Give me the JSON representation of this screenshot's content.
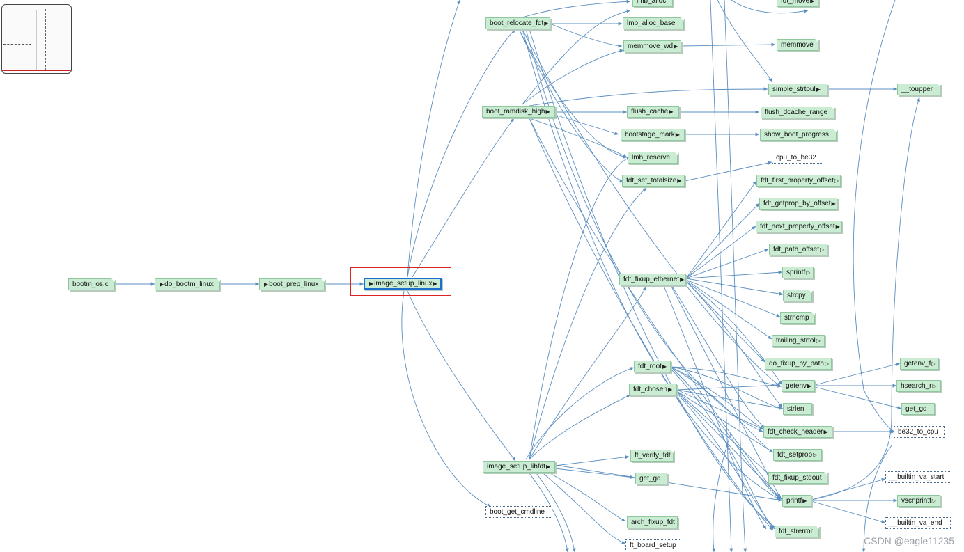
{
  "nodes": {
    "bootm_os_c": "bootm_os.c",
    "do_bootm_linux": "do_bootm_linux",
    "boot_prep_linux": "boot_prep_linux",
    "image_setup_linux": "image_setup_linux",
    "boot_relocate_fdt": "boot_relocate_fdt",
    "boot_ramdisk_high": "boot_ramdisk_high",
    "image_setup_libfdt": "image_setup_libfdt",
    "boot_get_cmdline": "boot_get_cmdline",
    "lmb_alloc": "lmb_alloc",
    "lmb_alloc_base": "lmb_alloc_base",
    "memmove_wd": "memmove_wd",
    "flush_cache": "flush_cache",
    "bootstage_mark": "bootstage_mark",
    "lmb_reserve": "lmb_reserve",
    "fdt_set_totalsize": "fdt_set_totalsize",
    "fdt_fixup_ethernet": "fdt_fixup_ethernet",
    "fdt_root": "fdt_root",
    "fdt_chosen": "fdt_chosen",
    "ft_verify_fdt": "ft_verify_fdt",
    "get_gd": "get_gd",
    "arch_fixup_fdt": "arch_fixup_fdt",
    "ft_board_setup": "ft_board_setup",
    "fdt_move": "fdt_move",
    "memmove": "memmove",
    "simple_strtoul": "simple_strtoul",
    "flush_dcache_range": "flush_dcache_range",
    "show_boot_progress": "show_boot_progress",
    "cpu_to_be32": "cpu_to_be32",
    "fdt_first_property_offset": "fdt_first_property_offset",
    "fdt_getprop_by_offset": "fdt_getprop_by_offset",
    "fdt_next_property_offset": "fdt_next_property_offset",
    "fdt_path_offset": "fdt_path_offset",
    "sprintf": "sprintf",
    "strcpy": "strcpy",
    "strncmp": "strncmp",
    "trailing_strtol": "trailing_strtol",
    "do_fixup_by_path": "do_fixup_by_path",
    "getenv": "getenv",
    "strlen": "strlen",
    "fdt_check_header": "fdt_check_header",
    "fdt_setprop": "fdt_setprop",
    "fdt_fixup_stdout": "fdt_fixup_stdout",
    "printf": "printf",
    "fdt_strerror": "fdt_strerror",
    "toupper": "__toupper",
    "getenv_f": "getenv_f",
    "hsearch_r": "hsearch_r",
    "get_gd_2": "get_gd",
    "be32_to_cpu": "be32_to_cpu",
    "builtin_va_start": "__builtin_va_start",
    "vscnprintf": "vscnprintf",
    "builtin_va_end": "__builtin_va_end"
  },
  "watermark": "CSDN @eagle11235",
  "colors": {
    "node_fill": "#c9ecd2",
    "node_border": "#8fc79f",
    "edge": "#5b8fc0",
    "selected_border": "#1f6fd0",
    "highlight_box": "#dd2222"
  }
}
